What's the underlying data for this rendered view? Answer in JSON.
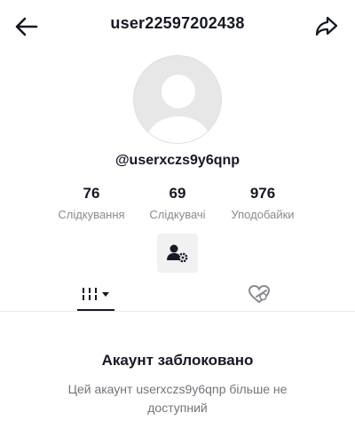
{
  "header": {
    "title": "user22597202438",
    "back_icon": "arrow-left-icon",
    "share_icon": "share-arrow-icon"
  },
  "profile": {
    "avatar_icon": "default-avatar-icon",
    "username": "@userxczs9y6qnp"
  },
  "stats": {
    "following_count": "76",
    "following_label": "Слідкування",
    "followers_count": "69",
    "followers_label": "Слідкувачі",
    "likes_count": "976",
    "likes_label": "Уподобайки"
  },
  "actions": {
    "settings_icon": "user-settings-icon"
  },
  "tabs": {
    "videos_icon": "grid-bars-dropdown-icon",
    "liked_icon": "heart-hidden-icon"
  },
  "blocked": {
    "title": "Акаунт заблоковано",
    "message": "Цей акаунт userxczs9y6qnp більше не доступний"
  },
  "colors": {
    "text_primary": "#161823",
    "text_secondary": "#8a8b91",
    "button_bg": "#f1f1f2",
    "avatar_bg": "#e7e7e7"
  }
}
